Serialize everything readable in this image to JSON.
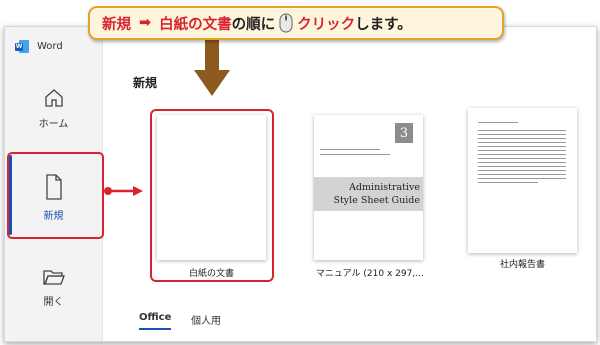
{
  "app": {
    "name": "Word"
  },
  "sidebar": {
    "items": [
      {
        "label": "ホーム",
        "icon": "home-icon"
      },
      {
        "label": "新規",
        "icon": "new-document-icon"
      },
      {
        "label": "開く",
        "icon": "open-folder-icon"
      }
    ]
  },
  "main": {
    "section_title": "新規",
    "templates": [
      {
        "label": "白紙の文書"
      },
      {
        "label": "マニュアル (210 x 297,…",
        "thumb_number": "3",
        "thumb_title_line1": "Administrative",
        "thumb_title_line2": "Style Sheet Guide"
      },
      {
        "label": "社内報告書"
      }
    ],
    "tabs": [
      {
        "label": "Office"
      },
      {
        "label": "個人用"
      }
    ]
  },
  "banner": {
    "part1": "新規",
    "arrow": "➡",
    "part2": "白紙の文書",
    "part3": "の順に",
    "part4": "クリック",
    "part5": "します。"
  },
  "colors": {
    "highlight": "#d9232e",
    "accent": "#1a4fb3",
    "banner_bg": "#fdf5dc",
    "banner_border": "#e3a12d"
  }
}
